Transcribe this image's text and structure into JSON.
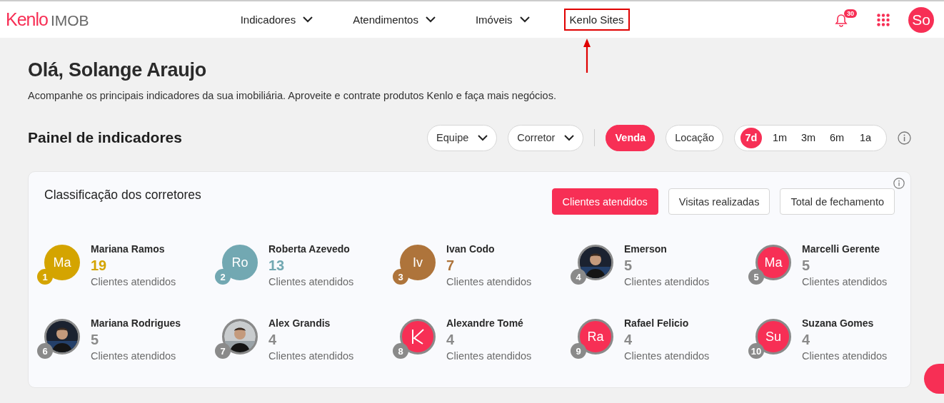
{
  "header": {
    "logo": {
      "brand": "Kenlo",
      "product": "IMOB"
    },
    "nav": [
      {
        "label": "Indicadores",
        "has_menu": true,
        "highlighted": false
      },
      {
        "label": "Atendimentos",
        "has_menu": true,
        "highlighted": false
      },
      {
        "label": "Imóveis",
        "has_menu": true,
        "highlighted": false
      },
      {
        "label": "Kenlo Sites",
        "has_menu": false,
        "highlighted": true
      }
    ],
    "notifications": "30",
    "profile": "So"
  },
  "greeting": {
    "title": "Olá, Solange Araujo",
    "subtitle": "Acompanhe os principais indicadores da sua imobiliária. Aproveite e contrate produtos Kenlo e faça mais negócios."
  },
  "panel": {
    "title": "Painel de indicadores",
    "dropdowns": [
      "Equipe",
      "Corretor"
    ],
    "business": [
      {
        "label": "Venda",
        "selected": true
      },
      {
        "label": "Locação",
        "selected": false
      }
    ],
    "periods": [
      {
        "label": "7d",
        "selected": true
      },
      {
        "label": "1m",
        "selected": false
      },
      {
        "label": "3m",
        "selected": false
      },
      {
        "label": "6m",
        "selected": false
      },
      {
        "label": "1a",
        "selected": false
      }
    ]
  },
  "ranking": {
    "title": "Classificação dos corretores",
    "metrics": [
      {
        "label": "Clientes atendidos",
        "selected": true
      },
      {
        "label": "Visitas realizadas",
        "selected": false
      },
      {
        "label": "Total de fechamento",
        "selected": false
      }
    ],
    "brokers": [
      {
        "rank": "1",
        "name": "Mariana Ramos",
        "count": "19",
        "caption": "Clientes atendidos",
        "color": "#d4a400",
        "avatar": {
          "kind": "initials",
          "initials": "Ma",
          "color": "#d4a400"
        }
      },
      {
        "rank": "2",
        "name": "Roberta Azevedo",
        "count": "13",
        "caption": "Clientes atendidos",
        "color": "#72a8b2",
        "avatar": {
          "kind": "initials",
          "initials": "Ro",
          "color": "#72a8b2"
        }
      },
      {
        "rank": "3",
        "name": "Ivan Codo",
        "count": "7",
        "caption": "Clientes atendidos",
        "color": "#ae743b",
        "avatar": {
          "kind": "initials",
          "initials": "Iv",
          "color": "#ae743b"
        }
      },
      {
        "rank": "4",
        "name": "Emerson",
        "count": "5",
        "caption": "Clientes atendidos",
        "color": "#8a8a8a"
      },
      {
        "rank": "5",
        "name": "Marcelli Gerente",
        "count": "5",
        "caption": "Clientes atendidos",
        "color": "#8a8a8a",
        "avatar": {
          "kind": "initials",
          "initials": "Ma",
          "color": "#f72f55"
        }
      },
      {
        "rank": "6",
        "name": "Mariana Rodrigues",
        "count": "5",
        "caption": "Clientes atendidos",
        "color": "#8a8a8a"
      },
      {
        "rank": "7",
        "name": "Alex Grandis",
        "count": "4",
        "caption": "Clientes atendidos",
        "color": "#8a8a8a"
      },
      {
        "rank": "8",
        "name": "Alexandre Tomé",
        "count": "4",
        "caption": "Clientes atendidos",
        "color": "#8a8a8a",
        "avatar": {
          "kind": "logo",
          "color": "#f72f55"
        }
      },
      {
        "rank": "9",
        "name": "Rafael Felicio",
        "count": "4",
        "caption": "Clientes atendidos",
        "color": "#8a8a8a",
        "avatar": {
          "kind": "initials",
          "initials": "Ra",
          "color": "#f72f55"
        }
      },
      {
        "rank": "10",
        "name": "Suzana Gomes",
        "count": "4",
        "caption": "Clientes atendidos",
        "color": "#8a8a8a",
        "avatar": {
          "kind": "initials",
          "initials": "Su",
          "color": "#f72f55"
        }
      }
    ]
  }
}
